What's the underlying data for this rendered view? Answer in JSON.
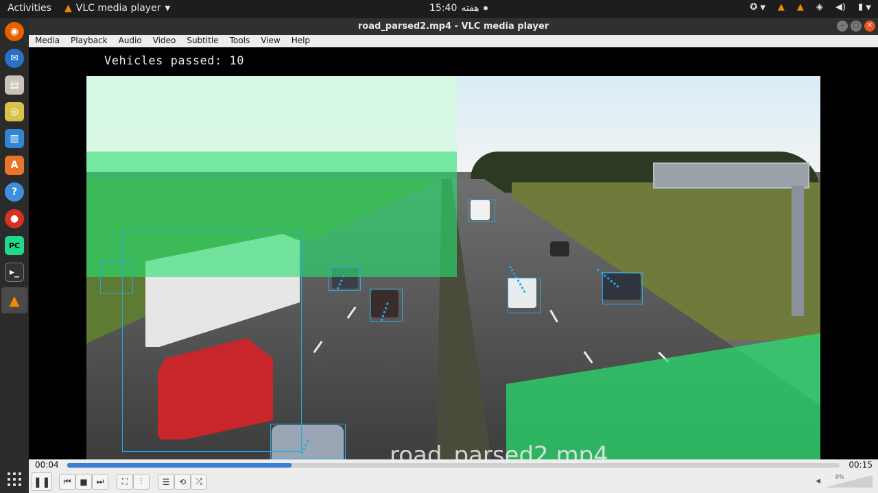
{
  "topbar": {
    "activities": "Activities",
    "app_name": "VLC media player",
    "clock": "15:40",
    "day": "هفته"
  },
  "window": {
    "title": "road_parsed2.mp4 - VLC media player"
  },
  "menu": [
    "Media",
    "Playback",
    "Audio",
    "Video",
    "Subtitle",
    "Tools",
    "View",
    "Help"
  ],
  "video": {
    "overlay_counter": "Vehicles passed: 10",
    "osd_filename": "road_parsed2.mp4",
    "detection_box_color": "#2aa7e0",
    "zone_color": "#28e16e"
  },
  "playback": {
    "current_time": "00:04",
    "total_time": "00:15",
    "progress": 0.29,
    "volume_label": "0%"
  },
  "dock_apps": [
    "firefox-icon",
    "thunderbird-icon",
    "files-icon",
    "rhythmbox-icon",
    "writer-icon",
    "software-icon",
    "help-icon",
    "chrome-icon",
    "pycharm-icon",
    "terminal-icon",
    "vlc-icon"
  ]
}
